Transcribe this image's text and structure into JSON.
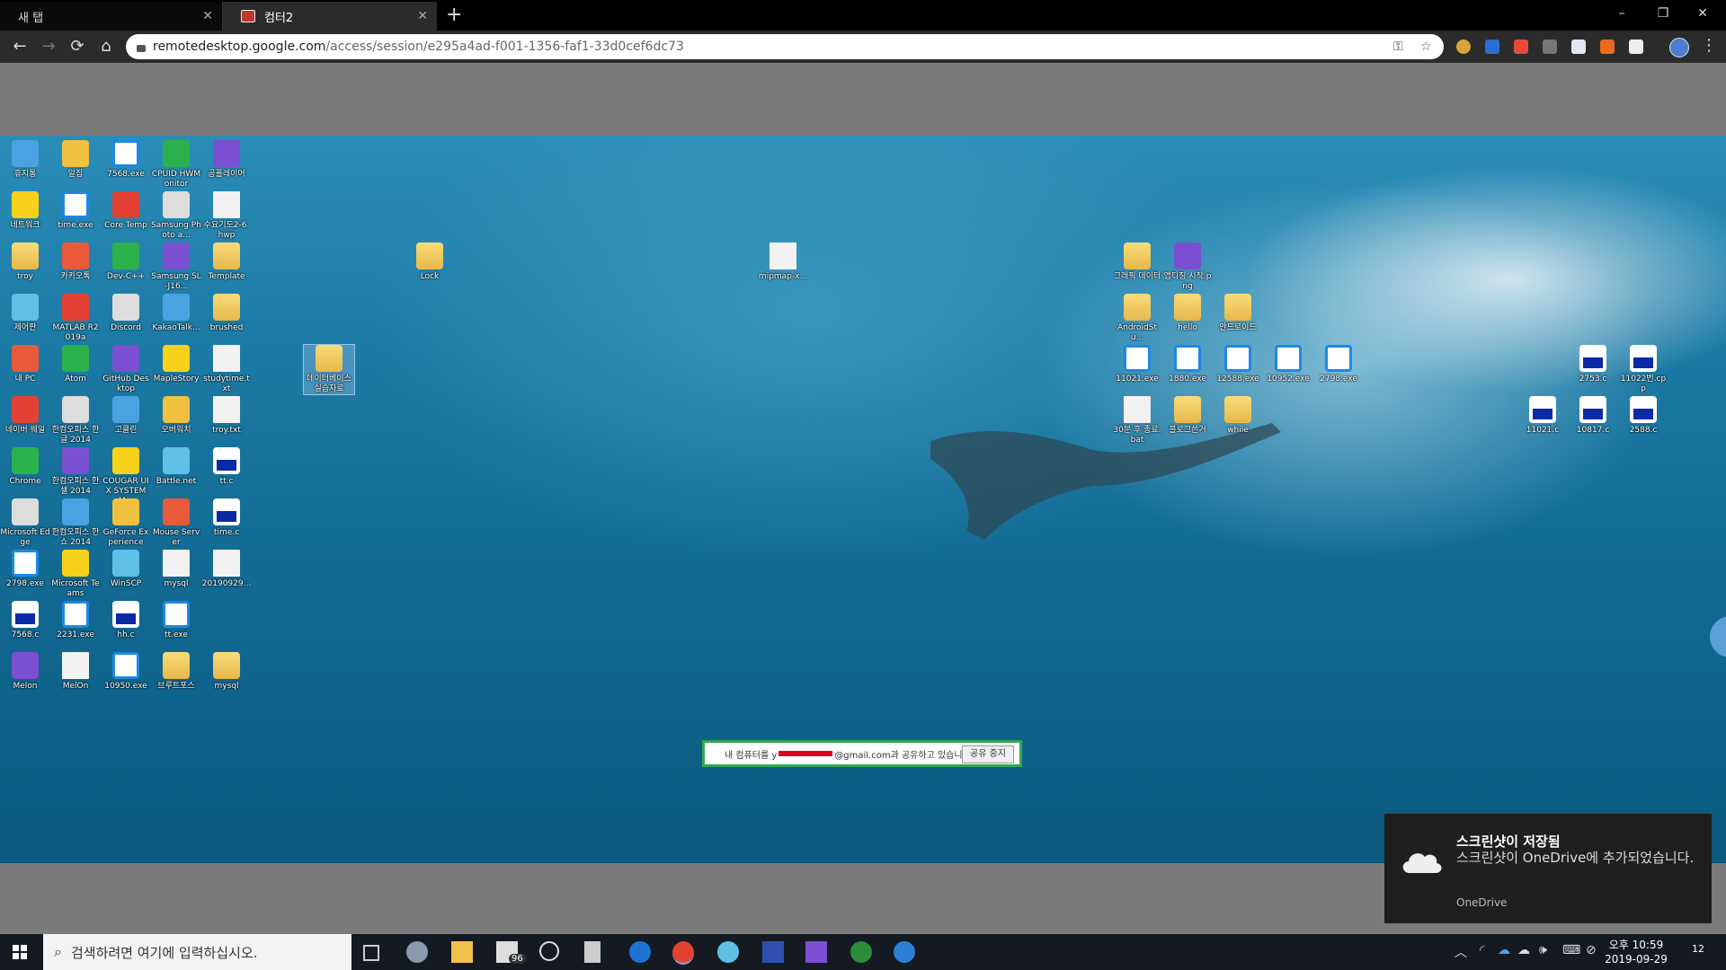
{
  "browser": {
    "tabs": [
      {
        "label": "새 탭",
        "active": false
      },
      {
        "label": "컴터2",
        "active": true
      }
    ],
    "new_tab": "+",
    "window_controls": {
      "minimize": "–",
      "restore": "❐",
      "close": "✕"
    },
    "nav": {
      "back": "←",
      "forward": "→",
      "reload": "⟳",
      "home": "⌂"
    },
    "url_host": "remotedesktop.google.com",
    "url_path": "/access/session/e295a4ad-f001-1356-faf1-33d0cef6dc73",
    "menu": "⋮"
  },
  "desktop_icons": [
    {
      "label": "휴지통",
      "kind": "recycle"
    },
    {
      "label": "알집",
      "kind": "app"
    },
    {
      "label": "7568.exe",
      "kind": "exe"
    },
    {
      "label": "CPUID HWMonitor",
      "kind": "app"
    },
    {
      "label": "곰플레이어",
      "kind": "app"
    },
    {
      "label": "네트워크",
      "kind": "net"
    },
    {
      "label": "time.exe",
      "kind": "exe"
    },
    {
      "label": "Core Temp",
      "kind": "app"
    },
    {
      "label": "Samsung Photo a...",
      "kind": "app"
    },
    {
      "label": "수요기도2-6.hwp",
      "kind": "file"
    },
    {
      "label": "troy",
      "kind": "folder"
    },
    {
      "label": "카카오톡",
      "kind": "app"
    },
    {
      "label": "Dev-C++",
      "kind": "app"
    },
    {
      "label": "Samsung SL-J16...",
      "kind": "app"
    },
    {
      "label": "Template",
      "kind": "folder"
    },
    {
      "label": "제어판",
      "kind": "app"
    },
    {
      "label": "MATLAB R2019a",
      "kind": "app"
    },
    {
      "label": "Discord",
      "kind": "app"
    },
    {
      "label": "KakaoTalk...",
      "kind": "app"
    },
    {
      "label": "brushed",
      "kind": "folder"
    },
    {
      "label": "내 PC",
      "kind": "pc"
    },
    {
      "label": "Atom",
      "kind": "app"
    },
    {
      "label": "GitHub Desktop",
      "kind": "app"
    },
    {
      "label": "MapleStory",
      "kind": "app"
    },
    {
      "label": "studytime.txt",
      "kind": "file"
    },
    {
      "label": "네이버 웨일",
      "kind": "app"
    },
    {
      "label": "한컴오피스 한글 2014",
      "kind": "app"
    },
    {
      "label": "고클린",
      "kind": "app"
    },
    {
      "label": "오버워치",
      "kind": "app"
    },
    {
      "label": "troy.txt",
      "kind": "file"
    },
    {
      "label": "Chrome",
      "kind": "app"
    },
    {
      "label": "한컴오피스 한셀 2014",
      "kind": "app"
    },
    {
      "label": "COUGAR UIX SYSTEM M...",
      "kind": "app"
    },
    {
      "label": "Battle.net",
      "kind": "app"
    },
    {
      "label": "tt.c",
      "kind": "cfile"
    },
    {
      "label": "Microsoft Edge",
      "kind": "app"
    },
    {
      "label": "한컴오피스 한쇼 2014",
      "kind": "app"
    },
    {
      "label": "GeForce Experience",
      "kind": "app"
    },
    {
      "label": "Mouse Server",
      "kind": "app"
    },
    {
      "label": "time.c",
      "kind": "cfile"
    },
    {
      "label": "2798.exe",
      "kind": "exe"
    },
    {
      "label": "Microsoft Teams",
      "kind": "app"
    },
    {
      "label": "WinSCP",
      "kind": "app"
    },
    {
      "label": "mysql",
      "kind": "file"
    },
    {
      "label": "20190929...",
      "kind": "file"
    },
    {
      "label": "7568.c",
      "kind": "cfile"
    },
    {
      "label": "2231.exe",
      "kind": "exe"
    },
    {
      "label": "hh.c",
      "kind": "cfile"
    },
    {
      "label": "tt.exe",
      "kind": "exe"
    },
    {
      "label": "Melon",
      "kind": "app"
    },
    {
      "label": "MelOn",
      "kind": "file"
    },
    {
      "label": "10950.exe",
      "kind": "exe"
    },
    {
      "label": "브루트포스",
      "kind": "folder"
    },
    {
      "label": "mysql",
      "kind": "folder"
    },
    {
      "label": "데이터베이스 실습자료",
      "kind": "folder"
    },
    {
      "label": "Lock",
      "kind": "folder"
    },
    {
      "label": "mipmap-x...",
      "kind": "file"
    },
    {
      "label": "그래픽 데이터",
      "kind": "folder"
    },
    {
      "label": "앱티징 시작.png",
      "kind": "img"
    },
    {
      "label": "AndroidStu...",
      "kind": "folder"
    },
    {
      "label": "hello",
      "kind": "folder"
    },
    {
      "label": "안드로이드",
      "kind": "folder"
    },
    {
      "label": "11021.exe",
      "kind": "exe"
    },
    {
      "label": "1880.exe",
      "kind": "exe"
    },
    {
      "label": "12588.exe",
      "kind": "exe"
    },
    {
      "label": "10952.exe",
      "kind": "exe"
    },
    {
      "label": "2798.exe",
      "kind": "exe"
    },
    {
      "label": "30분 후 종료.bat",
      "kind": "file"
    },
    {
      "label": "블로그쓴거",
      "kind": "folder"
    },
    {
      "label": "while",
      "kind": "folder"
    },
    {
      "label": "2753.c",
      "kind": "cfile"
    },
    {
      "label": "11022번.cpp",
      "kind": "cfile"
    },
    {
      "label": "11021.c",
      "kind": "cfile"
    },
    {
      "label": "10817.c",
      "kind": "cfile"
    },
    {
      "label": "2588.c",
      "kind": "cfile"
    }
  ],
  "share_bar": {
    "prefix": "내 컴퓨터를 y",
    "suffix": "@gmail.com과 공유하고 있습니다.",
    "stop_label": "공유 중지"
  },
  "toast": {
    "title": "스크린샷이 저장됨",
    "body": "스크린샷이 OneDrive에 추가되었습니다.",
    "source": "OneDrive"
  },
  "taskbar": {
    "search_placeholder": "검색하려면 여기에 입력하십시오.",
    "mail_badge": "96",
    "time": "오후 10:59",
    "date": "2019-09-29",
    "notifications": "12"
  },
  "colors": {
    "accent": "#33a853",
    "redact": "#e0001a",
    "taskbar": "#151a22"
  }
}
